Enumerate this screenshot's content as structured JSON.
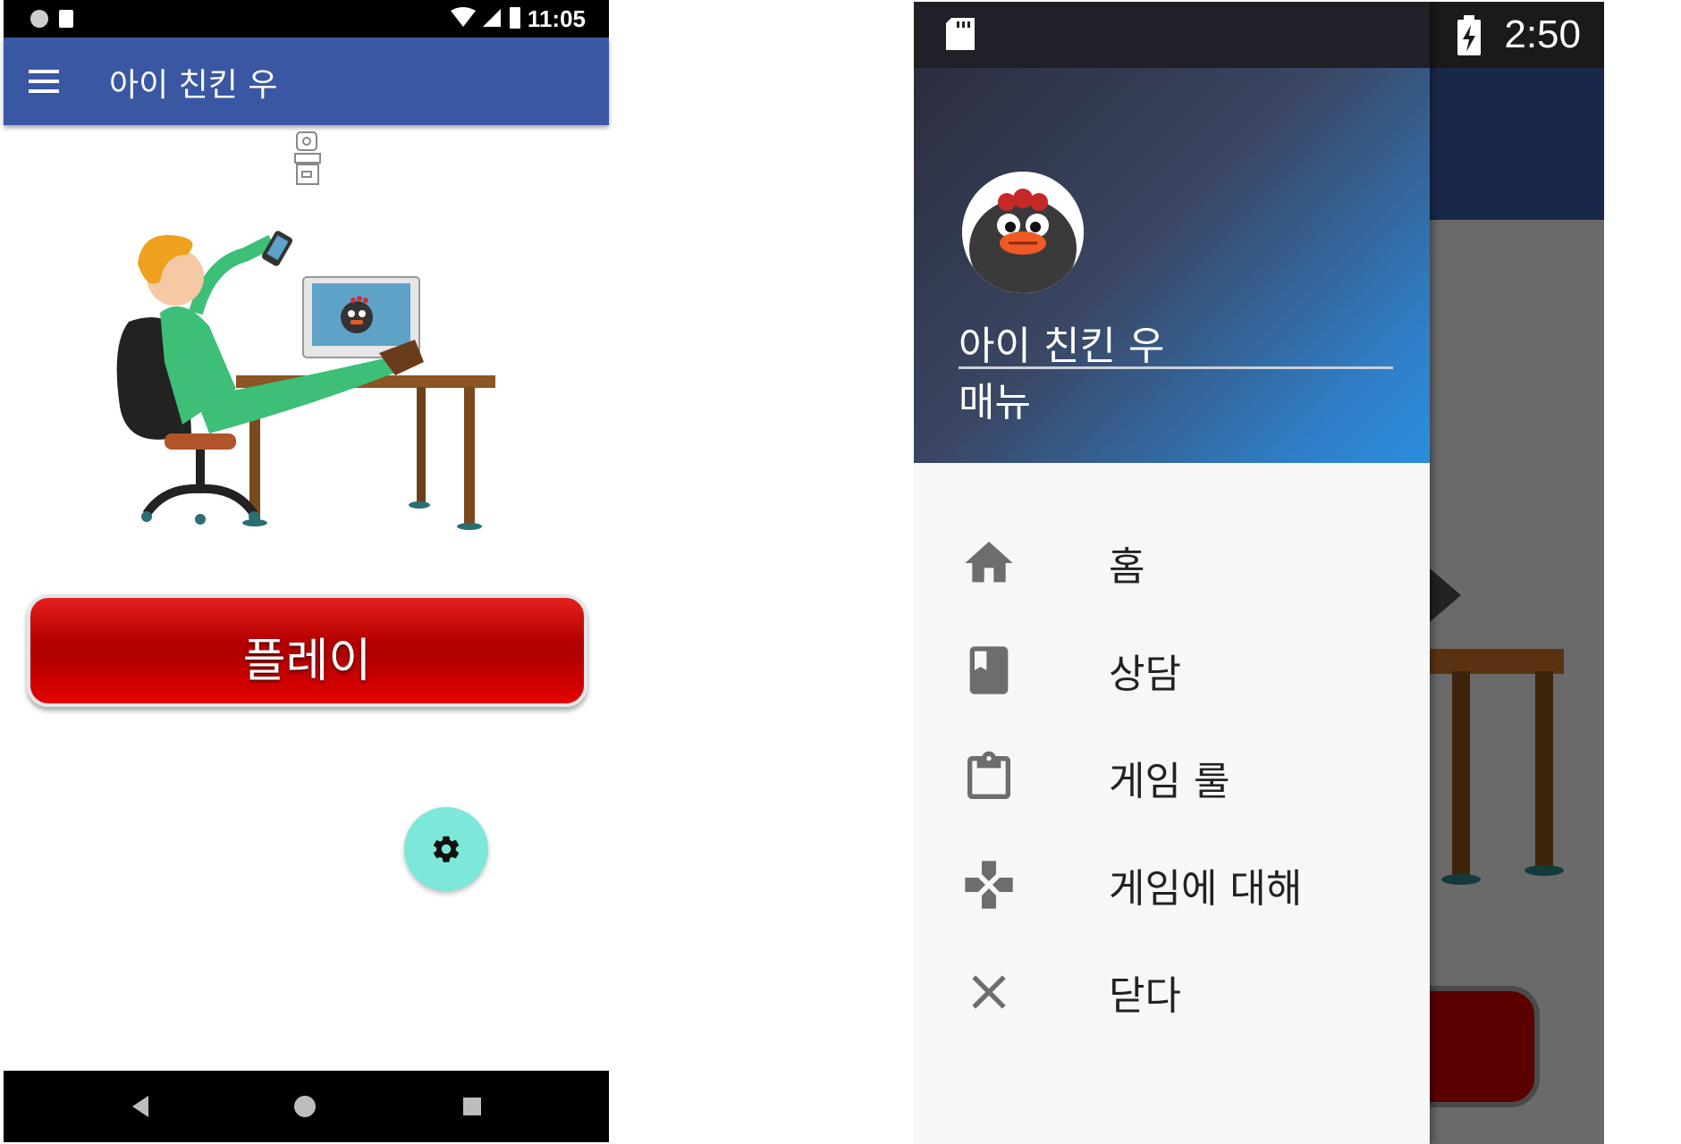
{
  "left_screen": {
    "status_bar": {
      "time": "11:05"
    },
    "app_bar": {
      "title": "아이 친킨 우"
    },
    "play_button": {
      "label": "플레이"
    },
    "fab": {
      "icon": "gear-icon",
      "color": "#7de8d9"
    },
    "nav_bar": {
      "back_icon": "back-triangle-icon",
      "home_icon": "home-circle-icon",
      "recents_icon": "recents-square-icon"
    }
  },
  "right_screen": {
    "status_bar": {
      "time": "2:50"
    },
    "drawer": {
      "header": {
        "title": "아이 친킨 우",
        "subtitle": "매뉴"
      },
      "items": [
        {
          "label": "홈",
          "icon": "home-icon"
        },
        {
          "label": "상담",
          "icon": "book-icon"
        },
        {
          "label": "게임 룰",
          "icon": "clipboard-icon"
        },
        {
          "label": "게임에 대해",
          "icon": "gamepad-icon"
        },
        {
          "label": "닫다",
          "icon": "close-icon"
        }
      ]
    }
  },
  "colors": {
    "app_bar_left": "#3a57a4",
    "play_button": "#c00000",
    "drawer_header_start": "#2b2d3c",
    "drawer_header_end": "#2a8ede",
    "menu_icon": "#6d6d6d"
  }
}
